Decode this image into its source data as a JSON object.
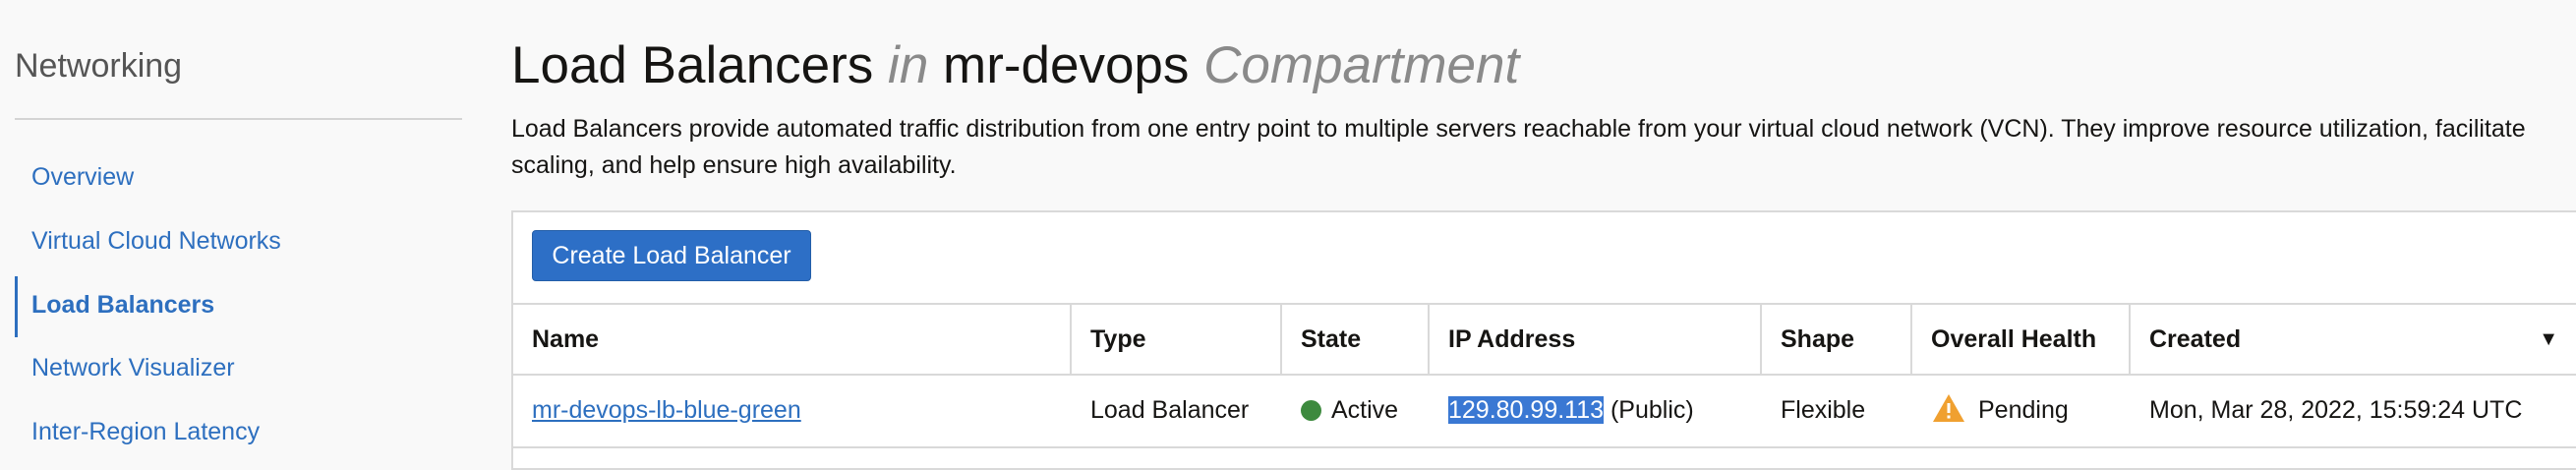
{
  "sidebar": {
    "title": "Networking",
    "items": [
      {
        "label": "Overview"
      },
      {
        "label": "Virtual Cloud Networks"
      },
      {
        "label": "Load Balancers",
        "active": true
      },
      {
        "label": "Network Visualizer"
      },
      {
        "label": "Inter-Region Latency"
      }
    ]
  },
  "header": {
    "title_main": "Load Balancers",
    "title_in": "in",
    "compartment": "mr-devops",
    "title_suffix": "Compartment",
    "description": "Load Balancers provide automated traffic distribution from one entry point to multiple servers reachable from your virtual cloud network (VCN). They improve resource utilization, facilitate scaling, and help ensure high availability."
  },
  "toolbar": {
    "create_label": "Create Load Balancer"
  },
  "table": {
    "columns": [
      "Name",
      "Type",
      "State",
      "IP Address",
      "Shape",
      "Overall Health",
      "Created"
    ],
    "rows": [
      {
        "name": "mr-devops-lb-blue-green",
        "type": "Load Balancer",
        "state": "Active",
        "ip": "129.80.99.113",
        "ip_scope": "(Public)",
        "shape": "Flexible",
        "health": "Pending",
        "created": "Mon, Mar 28, 2022, 15:59:24 UTC"
      }
    ]
  },
  "colors": {
    "accent": "#2d6fbf",
    "active_state": "#3d8a3e",
    "warning": "#f0a030",
    "selection": "#3a78d3"
  },
  "icons": {
    "sort": "caret-down-icon",
    "state": "status-dot-icon",
    "health": "warning-triangle-icon"
  }
}
